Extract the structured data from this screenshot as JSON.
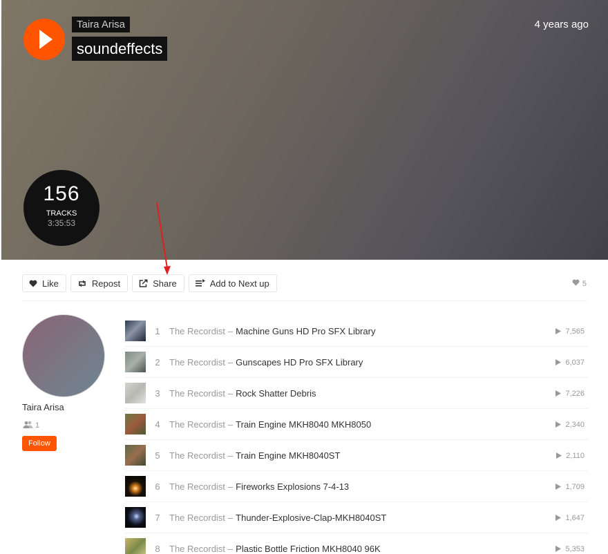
{
  "header": {
    "artist": "Taira Arisa",
    "title": "soundeffects",
    "posted": "4 years ago",
    "track_count": "156",
    "track_count_label": "TRACKS",
    "duration": "3:35:53"
  },
  "actions": {
    "like": "Like",
    "repost": "Repost",
    "share": "Share",
    "add_next": "Add to Next up",
    "likes_count": "5"
  },
  "user": {
    "name": "Taira Arisa",
    "followers": "1",
    "follow_label": "Follow"
  },
  "tracks": [
    {
      "num": "1",
      "artist": "The Recordist",
      "sep": "–",
      "title": "Machine Guns HD Pro SFX Library",
      "plays": "7,565"
    },
    {
      "num": "2",
      "artist": "The Recordist",
      "sep": "–",
      "title": "Gunscapes HD Pro SFX Library",
      "plays": "6,037"
    },
    {
      "num": "3",
      "artist": "The Recordist",
      "sep": "–",
      "title": "Rock Shatter Debris",
      "plays": "7,226"
    },
    {
      "num": "4",
      "artist": "The Recordist",
      "sep": "–",
      "title": "Train Engine MKH8040 MKH8050",
      "plays": "2,340"
    },
    {
      "num": "5",
      "artist": "The Recordist",
      "sep": "–",
      "title": "Train Engine MKH8040ST",
      "plays": "2,110"
    },
    {
      "num": "6",
      "artist": "The Recordist",
      "sep": "–",
      "title": "Fireworks Explosions 7-4-13",
      "plays": "1,709"
    },
    {
      "num": "7",
      "artist": "The Recordist",
      "sep": "–",
      "title": "Thunder-Explosive-Clap-MKH8040ST",
      "plays": "1,647"
    },
    {
      "num": "8",
      "artist": "The Recordist",
      "sep": "–",
      "title": "Plastic Bottle Friction MKH8040 96K",
      "plays": "5,353"
    }
  ],
  "colors": {
    "accent": "#ff5500",
    "annotation": "#e02020"
  }
}
